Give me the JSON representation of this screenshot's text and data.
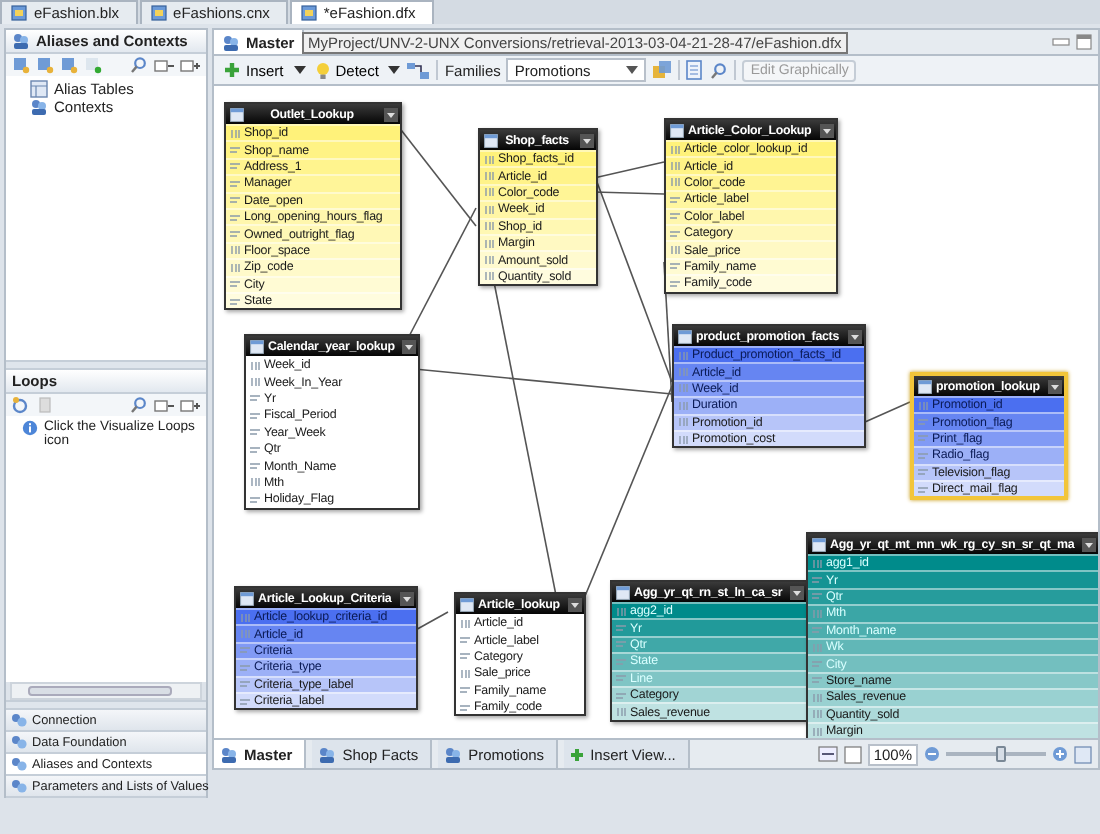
{
  "file_tabs": [
    {
      "label": "eFashion.blx",
      "selected": false
    },
    {
      "label": "eFashions.cnx",
      "selected": false
    },
    {
      "label": "*eFashion.dfx",
      "selected": true
    }
  ],
  "left_panel": {
    "title": "Aliases and Contexts",
    "tree": [
      {
        "label": "Alias Tables"
      },
      {
        "label": "Contexts"
      }
    ],
    "loops_title": "Loops",
    "loops_message": "Click the Visualize Loops icon",
    "nav": [
      {
        "label": "Connection",
        "selected": false
      },
      {
        "label": "Data Foundation",
        "selected": false
      },
      {
        "label": "Aliases and Contexts",
        "selected": true
      },
      {
        "label": "Parameters and Lists of Values",
        "selected": false
      }
    ]
  },
  "editor": {
    "tab": "Master",
    "tooltip": "MyProject/UNV-2-UNX Conversions/retrieval-2013-03-04-21-28-47/eFashion.dfx",
    "toolbar": {
      "insert": "Insert",
      "detect": "Detect",
      "families_label": "Families",
      "families_value": "Promotions",
      "edit_button": {
        "label": "Edit Graphically",
        "disabled": true
      }
    },
    "tables": [
      {
        "name": "Outlet_Lookup",
        "color": "#fff27a",
        "selected": false,
        "columns": [
          {
            "name": "Shop_id",
            "kind": "number"
          },
          {
            "name": "Shop_name",
            "kind": "text"
          },
          {
            "name": "Address_1",
            "kind": "text"
          },
          {
            "name": "Manager",
            "kind": "text"
          },
          {
            "name": "Date_open",
            "kind": "text"
          },
          {
            "name": "Long_opening_hours_flag",
            "kind": "text"
          },
          {
            "name": "Owned_outright_flag",
            "kind": "text"
          },
          {
            "name": "Floor_space",
            "kind": "number"
          },
          {
            "name": "Zip_code",
            "kind": "number"
          },
          {
            "name": "City",
            "kind": "text"
          },
          {
            "name": "State",
            "kind": "text"
          }
        ]
      },
      {
        "name": "Shop_facts",
        "color": "#fff27a",
        "selected": false,
        "columns": [
          {
            "name": "Shop_facts_id",
            "kind": "number"
          },
          {
            "name": "Article_id",
            "kind": "number"
          },
          {
            "name": "Color_code",
            "kind": "number"
          },
          {
            "name": "Week_id",
            "kind": "number"
          },
          {
            "name": "Shop_id",
            "kind": "number"
          },
          {
            "name": "Margin",
            "kind": "number"
          },
          {
            "name": "Amount_sold",
            "kind": "number"
          },
          {
            "name": "Quantity_sold",
            "kind": "number"
          }
        ]
      },
      {
        "name": "Article_Color_Lookup",
        "color": "#fff27a",
        "selected": false,
        "columns": [
          {
            "name": "Article_color_lookup_id",
            "kind": "number"
          },
          {
            "name": "Article_id",
            "kind": "number"
          },
          {
            "name": "Color_code",
            "kind": "number"
          },
          {
            "name": "Article_label",
            "kind": "text"
          },
          {
            "name": "Color_label",
            "kind": "text"
          },
          {
            "name": "Category",
            "kind": "text"
          },
          {
            "name": "Sale_price",
            "kind": "number"
          },
          {
            "name": "Family_name",
            "kind": "text"
          },
          {
            "name": "Family_code",
            "kind": "text"
          }
        ]
      },
      {
        "name": "Calendar_year_lookup",
        "color": "#ffffff",
        "selected": false,
        "columns": [
          {
            "name": "Week_id",
            "kind": "number"
          },
          {
            "name": "Week_In_Year",
            "kind": "number"
          },
          {
            "name": "Yr",
            "kind": "text"
          },
          {
            "name": "Fiscal_Period",
            "kind": "text"
          },
          {
            "name": "Year_Week",
            "kind": "text"
          },
          {
            "name": "Qtr",
            "kind": "text"
          },
          {
            "name": "Month_Name",
            "kind": "text"
          },
          {
            "name": "Mth",
            "kind": "number"
          },
          {
            "name": "Holiday_Flag",
            "kind": "text"
          }
        ]
      },
      {
        "name": "product_promotion_facts",
        "color": "#4b6ff0",
        "selected": false,
        "columns": [
          {
            "name": "Product_promotion_facts_id",
            "kind": "number"
          },
          {
            "name": "Article_id",
            "kind": "number"
          },
          {
            "name": "Week_id",
            "kind": "number"
          },
          {
            "name": "Duration",
            "kind": "number"
          },
          {
            "name": "Promotion_id",
            "kind": "number"
          },
          {
            "name": "Promotion_cost",
            "kind": "number"
          }
        ]
      },
      {
        "name": "promotion_lookup",
        "color": "#4b6ff0",
        "selected": true,
        "columns": [
          {
            "name": "Promotion_id",
            "kind": "number"
          },
          {
            "name": "Promotion_flag",
            "kind": "text"
          },
          {
            "name": "Print_flag",
            "kind": "text"
          },
          {
            "name": "Radio_flag",
            "kind": "text"
          },
          {
            "name": "Television_flag",
            "kind": "text"
          },
          {
            "name": "Direct_mail_flag",
            "kind": "text"
          }
        ]
      },
      {
        "name": "Article_Lookup_Criteria",
        "color": "#4b6ff0",
        "selected": false,
        "columns": [
          {
            "name": "Article_lookup_criteria_id",
            "kind": "number"
          },
          {
            "name": "Article_id",
            "kind": "number"
          },
          {
            "name": "Criteria",
            "kind": "text"
          },
          {
            "name": "Criteria_type",
            "kind": "text"
          },
          {
            "name": "Criteria_type_label",
            "kind": "text"
          },
          {
            "name": "Criteria_label",
            "kind": "text"
          }
        ]
      },
      {
        "name": "Article_lookup",
        "color": "#ffffff",
        "selected": false,
        "columns": [
          {
            "name": "Article_id",
            "kind": "number"
          },
          {
            "name": "Article_label",
            "kind": "text"
          },
          {
            "name": "Category",
            "kind": "text"
          },
          {
            "name": "Sale_price",
            "kind": "number"
          },
          {
            "name": "Family_name",
            "kind": "text"
          },
          {
            "name": "Family_code",
            "kind": "text"
          }
        ]
      },
      {
        "name": "Agg_yr_qt_rn_st_ln_ca_sr",
        "color": "#008b8b",
        "selected": false,
        "columns": [
          {
            "name": "agg2_id",
            "kind": "number"
          },
          {
            "name": "Yr",
            "kind": "text"
          },
          {
            "name": "Qtr",
            "kind": "text"
          },
          {
            "name": "State",
            "kind": "text"
          },
          {
            "name": "Line",
            "kind": "text"
          },
          {
            "name": "Category",
            "kind": "text"
          },
          {
            "name": "Sales_revenue",
            "kind": "number"
          }
        ]
      },
      {
        "name": "Agg_yr_qt_mt_mn_wk_rg_cy_sn_sr_qt_ma",
        "color": "#008b8b",
        "selected": false,
        "columns": [
          {
            "name": "agg1_id",
            "kind": "number"
          },
          {
            "name": "Yr",
            "kind": "text"
          },
          {
            "name": "Qtr",
            "kind": "text"
          },
          {
            "name": "Mth",
            "kind": "number"
          },
          {
            "name": "Month_name",
            "kind": "text"
          },
          {
            "name": "Wk",
            "kind": "number"
          },
          {
            "name": "City",
            "kind": "text"
          },
          {
            "name": "Store_name",
            "kind": "text"
          },
          {
            "name": "Sales_revenue",
            "kind": "number"
          },
          {
            "name": "Quantity_sold",
            "kind": "number"
          },
          {
            "name": "Margin",
            "kind": "number"
          }
        ]
      }
    ],
    "view_tabs": [
      {
        "label": "Master",
        "kind": "view",
        "selected": true
      },
      {
        "label": "Shop Facts",
        "kind": "view",
        "selected": false
      },
      {
        "label": "Promotions",
        "kind": "view",
        "selected": false
      },
      {
        "label": "Insert View...",
        "kind": "add",
        "selected": false
      }
    ],
    "zoom": {
      "value": "100%",
      "level": 0.55
    }
  }
}
